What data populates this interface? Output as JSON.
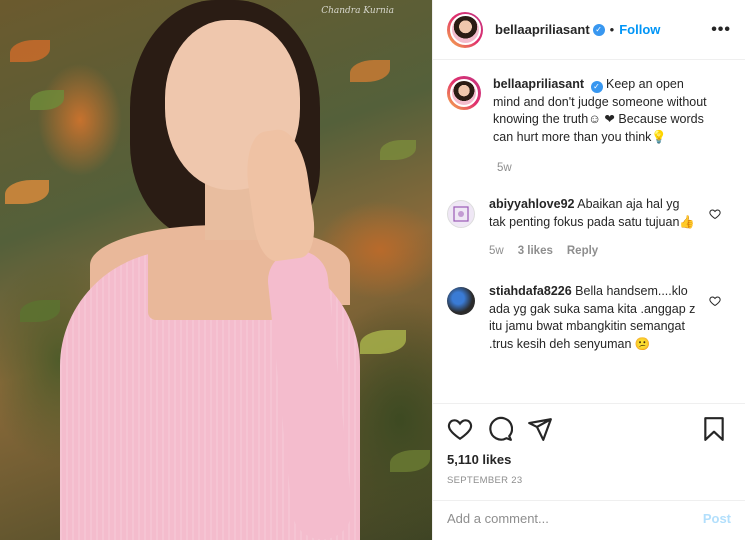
{
  "photo": {
    "watermark": "Chandra Kurnia"
  },
  "header": {
    "username": "bellaapriliasant",
    "separator": "•",
    "follow_label": "Follow",
    "more_label": "•••"
  },
  "caption": {
    "username": "bellaapriliasant",
    "text": "Keep an open mind and don't judge someone without knowing the truth☺ ❤ Because words can hurt more than you think💡",
    "time": "5w"
  },
  "comments": [
    {
      "username": "abiyyahlove92",
      "text": "Abaikan aja hal yg tak penting fokus pada satu tujuan👍",
      "time": "5w",
      "likes": "3 likes",
      "reply_label": "Reply"
    },
    {
      "username": "stiahdafa8226",
      "text": "Bella handsem....klo ada yg gak suka sama kita .anggap z itu jamu bwat mbangkitin semangat .trus kesih deh senyuman 😕"
    }
  ],
  "post": {
    "likes": "5,110 likes",
    "date": "SEPTEMBER 23"
  },
  "add_comment": {
    "placeholder": "Add a comment...",
    "post_label": "Post"
  },
  "colors": {
    "accent": "#0095f6",
    "verified": "#3897f0",
    "heart": "#ed4956",
    "muted": "#8e8e8e"
  },
  "icons": [
    "verified-icon",
    "more-icon",
    "heart-icon",
    "comment-icon",
    "share-icon",
    "bookmark-icon"
  ]
}
